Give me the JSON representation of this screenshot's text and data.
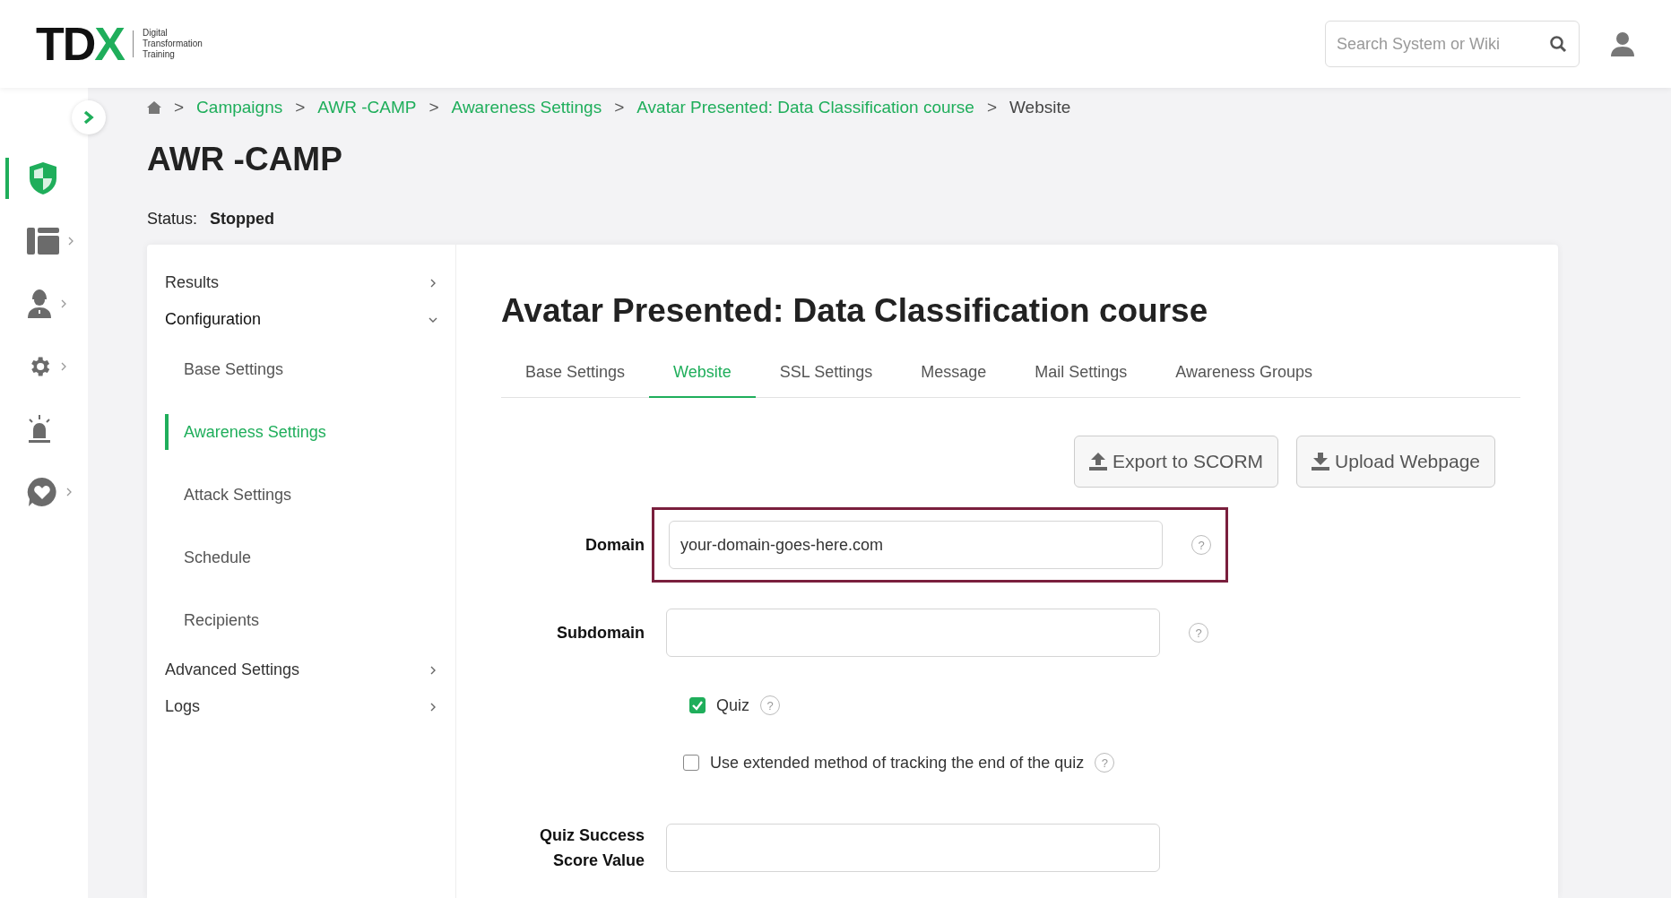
{
  "header": {
    "logo": {
      "parts": [
        {
          "text": "TD",
          "kind": "dark"
        },
        {
          "text": "X",
          "kind": "accent"
        }
      ],
      "tagline": [
        "Digital",
        "Transformation",
        "Training"
      ]
    },
    "search": {
      "placeholder": "Search System or Wiki"
    }
  },
  "rail": {
    "items": [
      {
        "kind": "shield",
        "selected": true,
        "expandable": false
      },
      {
        "kind": "layout",
        "selected": false,
        "expandable": true
      },
      {
        "kind": "person",
        "selected": false,
        "expandable": true
      },
      {
        "kind": "gear",
        "selected": false,
        "expandable": true
      },
      {
        "kind": "alarm",
        "selected": false,
        "expandable": false
      },
      {
        "kind": "heart",
        "selected": false,
        "expandable": true
      }
    ]
  },
  "breadcrumb": [
    {
      "label": "Campaigns",
      "current": false
    },
    {
      "label": "AWR -CAMP",
      "current": false
    },
    {
      "label": "Awareness Settings",
      "current": false
    },
    {
      "label": "Avatar Presented: Data Classification course",
      "current": false
    },
    {
      "label": "Website",
      "current": true
    }
  ],
  "breadcrumb_separator": ">",
  "page": {
    "title": "AWR -CAMP",
    "status_label": "Status:",
    "status_value": "Stopped"
  },
  "nav": [
    {
      "label": "Results",
      "expanded": false
    },
    {
      "label": "Configuration",
      "expanded": true,
      "children": [
        {
          "label": "Base Settings",
          "selected": false
        },
        {
          "label": "Awareness Settings",
          "selected": true
        },
        {
          "label": "Attack Settings",
          "selected": false
        },
        {
          "label": "Schedule",
          "selected": false
        },
        {
          "label": "Recipients",
          "selected": false
        }
      ]
    },
    {
      "label": "Advanced Settings",
      "expanded": false
    },
    {
      "label": "Logs",
      "expanded": false
    }
  ],
  "content": {
    "heading": "Avatar Presented: Data Classification course",
    "tabs": [
      {
        "label": "Base Settings",
        "selected": false
      },
      {
        "label": "Website",
        "selected": true
      },
      {
        "label": "SSL Settings",
        "selected": false
      },
      {
        "label": "Message",
        "selected": false
      },
      {
        "label": "Mail Settings",
        "selected": false
      },
      {
        "label": "Awareness Groups",
        "selected": false
      }
    ],
    "buttons": [
      {
        "label": "Export to SCORM",
        "kind": "upload"
      },
      {
        "label": "Upload Webpage",
        "kind": "download"
      }
    ],
    "fields": [
      {
        "kind": "text",
        "label": "Domain",
        "value": "your-domain-goes-here.com",
        "help": "?",
        "highlighted": true
      },
      {
        "kind": "text",
        "label": "Subdomain",
        "help": "?",
        "highlighted": false
      },
      {
        "kind": "checkbox",
        "label": "Quiz",
        "checked": true,
        "help": "?"
      },
      {
        "kind": "checkbox",
        "label": "Use extended method of tracking the end of the quiz",
        "checked": false,
        "help": "?"
      },
      {
        "kind": "text",
        "label": "Quiz Success Score Value",
        "highlighted": false
      }
    ]
  }
}
